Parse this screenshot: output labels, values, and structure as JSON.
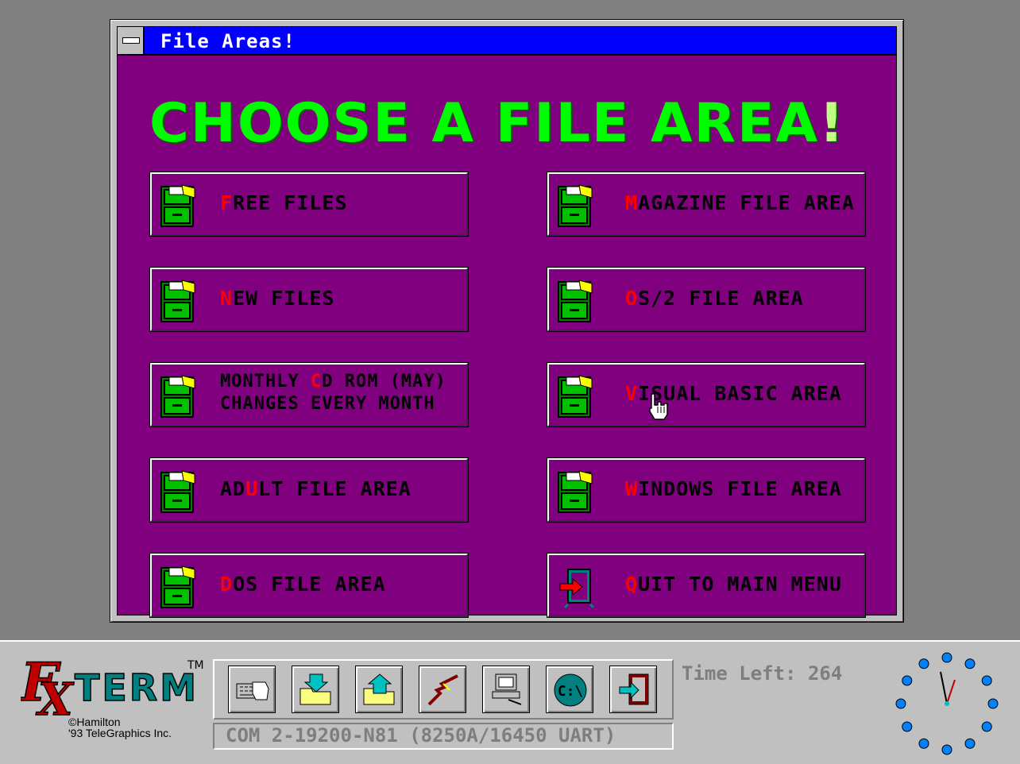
{
  "window": {
    "title": "File Areas!",
    "headline_main": "CHOOSE A FILE AREA",
    "headline_bang": "!"
  },
  "areas": [
    {
      "id": "free-files",
      "hot": "F",
      "rest": "REE FILES",
      "icon": "file-cabinet-icon"
    },
    {
      "id": "new-files",
      "hot": "N",
      "rest": "EW FILES",
      "icon": "file-cabinet-icon"
    },
    {
      "id": "monthly-cd-rom",
      "line1_pre": "MONTHLY ",
      "hot": "C",
      "line1_post": "D ROM (MAY)",
      "line2": "CHANGES EVERY MONTH",
      "icon": "file-cabinet-icon"
    },
    {
      "id": "adult-file-area",
      "pre": "AD",
      "hot": "U",
      "rest": "LT FILE AREA",
      "icon": "file-cabinet-icon"
    },
    {
      "id": "dos-file-area",
      "hot": "D",
      "rest": "OS FILE AREA",
      "icon": "file-cabinet-icon"
    },
    {
      "id": "magazine-file-area",
      "hot": "M",
      "rest": "AGAZINE FILE AREA",
      "icon": "file-cabinet-icon"
    },
    {
      "id": "os2-file-area",
      "hot": "O",
      "rest": "S/2 FILE AREA",
      "icon": "file-cabinet-icon"
    },
    {
      "id": "visual-basic-area",
      "hot": "V",
      "rest": "ISUAL BASIC AREA",
      "icon": "file-cabinet-icon"
    },
    {
      "id": "windows-file-area",
      "hot": "W",
      "rest": "INDOWS FILE AREA",
      "icon": "file-cabinet-icon"
    },
    {
      "id": "quit-to-main-menu",
      "hot": "Q",
      "rest": "UIT TO MAIN MENU",
      "icon": "exit-door-icon"
    }
  ],
  "toolbar": {
    "logo_text": "TERM",
    "logo_tm": "TM",
    "copyright_line1": "©Hamilton",
    "copyright_line2": "'93 TeleGraphics Inc.",
    "buttons": [
      {
        "id": "keyboard",
        "icon": "keyboard-hand-icon"
      },
      {
        "id": "download",
        "icon": "download-folder-icon"
      },
      {
        "id": "upload",
        "icon": "upload-folder-icon"
      },
      {
        "id": "hangup",
        "icon": "broken-cable-icon"
      },
      {
        "id": "terminal",
        "icon": "computer-icon"
      },
      {
        "id": "dos-shell",
        "icon": "dos-prompt-icon",
        "label": "C:\\"
      },
      {
        "id": "exit",
        "icon": "exit-door-icon"
      }
    ],
    "status": "COM 2-19200-N81 (8250A/16450 UART)",
    "time_left_label": "Time Left:",
    "time_left_value": "264"
  },
  "colors": {
    "title_bar": "#0000fc",
    "content_bg": "#800080",
    "headline": "#00fc00",
    "hotkey": "#fc0000",
    "toolbar_bg": "#c0c0c0"
  }
}
